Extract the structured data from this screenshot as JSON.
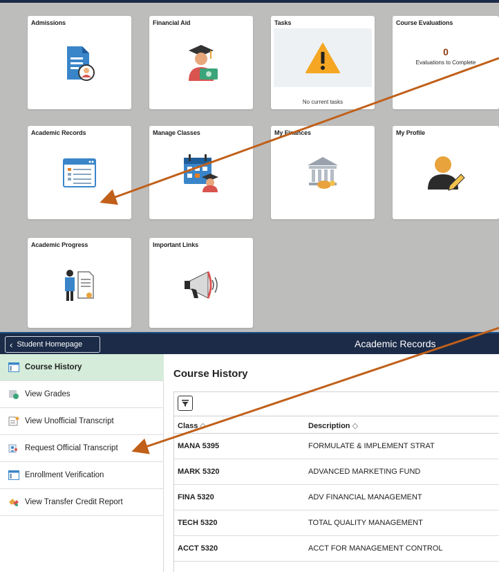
{
  "home": {
    "tiles": [
      {
        "title": "Admissions"
      },
      {
        "title": "Financial Aid"
      },
      {
        "title": "Tasks",
        "subtext": "No current tasks"
      },
      {
        "title": "Course Evaluations",
        "count": "0",
        "label": "Evaluations to Complete"
      },
      {
        "title": "Academic Records"
      },
      {
        "title": "Manage Classes"
      },
      {
        "title": "My Finances"
      },
      {
        "title": "My Profile"
      },
      {
        "title": "Academic Progress"
      },
      {
        "title": "Important Links"
      }
    ]
  },
  "records": {
    "back_label": "Student Homepage",
    "page_title": "Academic Records",
    "nav": [
      {
        "label": "Course History",
        "icon": "table-icon"
      },
      {
        "label": "View Grades",
        "icon": "grades-icon"
      },
      {
        "label": "View Unofficial Transcript",
        "icon": "transcript-icon"
      },
      {
        "label": "Request Official Transcript",
        "icon": "request-icon"
      },
      {
        "label": "Enrollment Verification",
        "icon": "table-icon"
      },
      {
        "label": "View Transfer Credit Report",
        "icon": "transfer-icon"
      }
    ],
    "content_title": "Course History",
    "columns": {
      "class": "Class",
      "description": "Description"
    },
    "rows": [
      {
        "class": "MANA 5395",
        "description": "FORMULATE & IMPLEMENT STRAT"
      },
      {
        "class": "MARK 5320",
        "description": "ADVANCED MARKETING FUND"
      },
      {
        "class": "FINA 5320",
        "description": "ADV FINANCIAL MANAGEMENT"
      },
      {
        "class": "TECH 5320",
        "description": "TOTAL QUALITY MANAGEMENT"
      },
      {
        "class": "ACCT 5320",
        "description": "ACCT FOR MANAGEMENT CONTROL"
      }
    ]
  },
  "colors": {
    "banner": "#1c2b48",
    "active_nav": "#d4ecd9",
    "annotation_arrow": "#c0601a",
    "eval_count": "#8b3a0e"
  }
}
